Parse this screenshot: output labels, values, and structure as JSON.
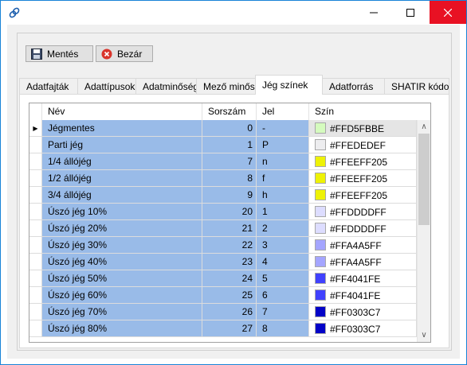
{
  "toolbar": {
    "save_label": "Mentés",
    "close_label": "Bezár"
  },
  "tabs": [
    {
      "label": "Adatfajták"
    },
    {
      "label": "Adattípusok"
    },
    {
      "label": "Adatminőség"
    },
    {
      "label": "Mező minősítés"
    },
    {
      "label": "Jég színek"
    },
    {
      "label": "Adatforrás"
    },
    {
      "label": "SHATIR kódok"
    }
  ],
  "active_tab": "Jég színek",
  "grid": {
    "columns": [
      "Név",
      "Sorszám",
      "Jel",
      "Szín"
    ],
    "rows": [
      {
        "name": "Jégmentes",
        "order": "0",
        "sign": "-",
        "color": "#FFD5FBBE",
        "hex": "#D5FBBE"
      },
      {
        "name": "Parti jég",
        "order": "1",
        "sign": "P",
        "color": "#FFEDEDEF",
        "hex": "#EDEDEF"
      },
      {
        "name": "1/4 állójég",
        "order": "7",
        "sign": "n",
        "color": "#FFEEFF205",
        "hex": "#EEF205"
      },
      {
        "name": "1/2 állójég",
        "order": "8",
        "sign": "f",
        "color": "#FFEEFF205",
        "hex": "#EEF205"
      },
      {
        "name": "3/4 állójég",
        "order": "9",
        "sign": "h",
        "color": "#FFEEFF205",
        "hex": "#EEF205"
      },
      {
        "name": "Úszó jég 10%",
        "order": "20",
        "sign": "1",
        "color": "#FFDDDDFF",
        "hex": "#DDDDFF"
      },
      {
        "name": "Úszó jég 20%",
        "order": "21",
        "sign": "2",
        "color": "#FFDDDDFF",
        "hex": "#DDDDFF"
      },
      {
        "name": "Úszó jég 30%",
        "order": "22",
        "sign": "3",
        "color": "#FFA4A5FF",
        "hex": "#A4A5FF"
      },
      {
        "name": "Úszó jég 40%",
        "order": "23",
        "sign": "4",
        "color": "#FFA4A5FF",
        "hex": "#A4A5FF"
      },
      {
        "name": "Úszó jég 50%",
        "order": "24",
        "sign": "5",
        "color": "#FF4041FE",
        "hex": "#4041FE"
      },
      {
        "name": "Úszó jég 60%",
        "order": "25",
        "sign": "6",
        "color": "#FF4041FE",
        "hex": "#4041FE"
      },
      {
        "name": "Úszó jég 70%",
        "order": "26",
        "sign": "7",
        "color": "#FF0303C7",
        "hex": "#0303C7"
      },
      {
        "name": "Úszó jég 80%",
        "order": "27",
        "sign": "8",
        "color": "#FF0303C7",
        "hex": "#0303C7"
      }
    ]
  },
  "colors": {
    "selection": "#99bbe8",
    "close_button": "#e81123",
    "window_border": "#1883d7"
  }
}
